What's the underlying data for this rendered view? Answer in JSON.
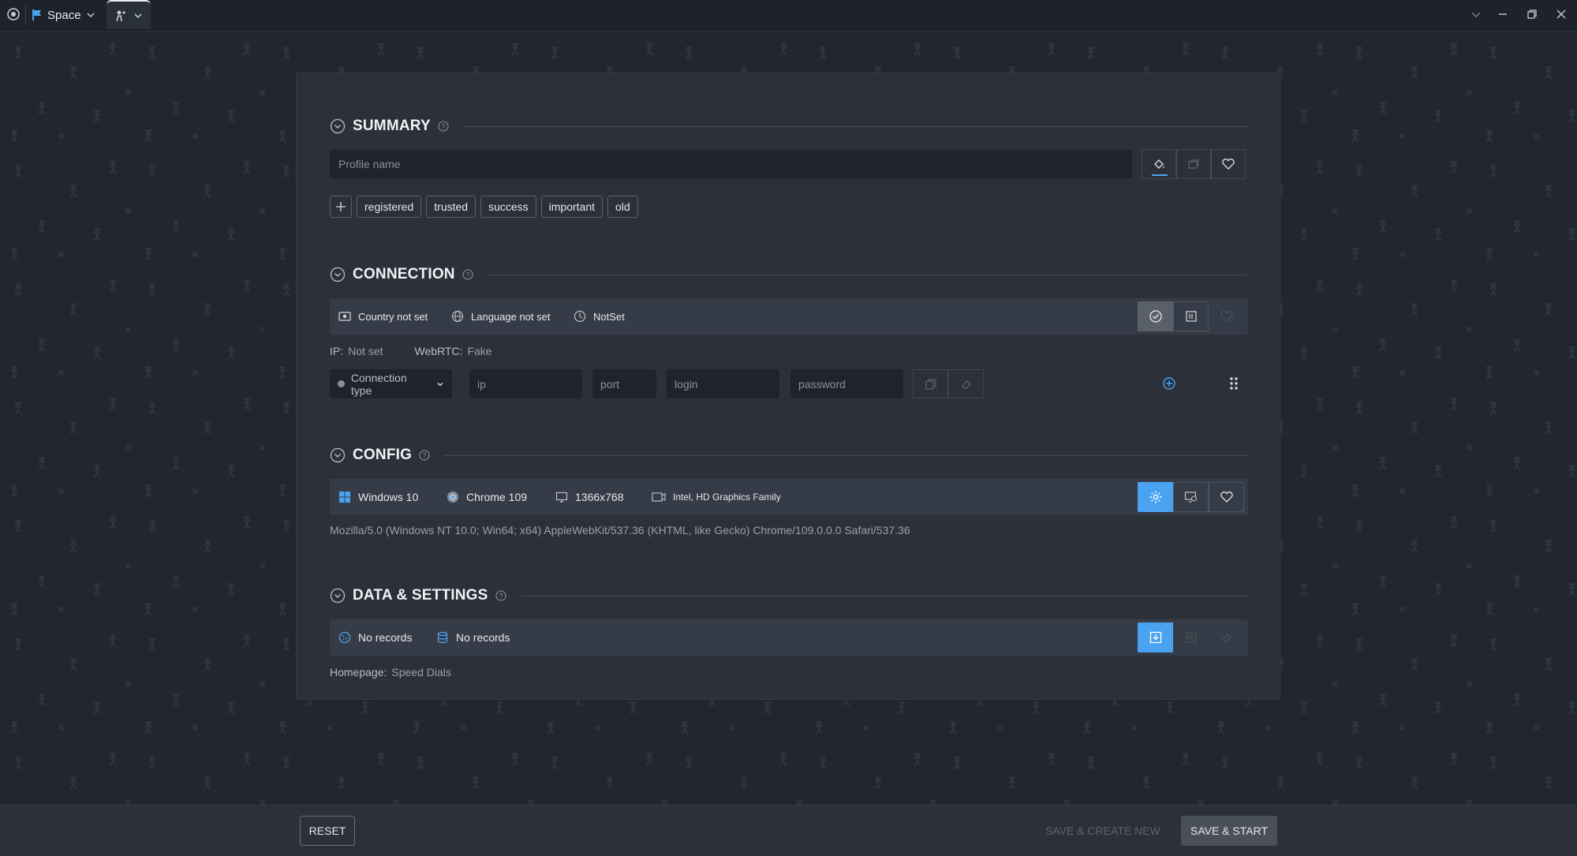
{
  "titlebar": {
    "space_label": "Space"
  },
  "summary": {
    "title": "SUMMARY",
    "profile_name_placeholder": "Profile name",
    "tags": [
      "registered",
      "trusted",
      "success",
      "important",
      "old"
    ]
  },
  "connection": {
    "title": "CONNECTION",
    "country": "Country not set",
    "language": "Language not set",
    "timezone": "NotSet",
    "ip_label": "IP:",
    "ip_value": "Not set",
    "webrtc_label": "WebRTC:",
    "webrtc_value": "Fake",
    "connection_type": "Connection type",
    "ip_placeholder": "ip",
    "port_placeholder": "port",
    "login_placeholder": "login",
    "password_placeholder": "password"
  },
  "config": {
    "title": "CONFIG",
    "os": "Windows 10",
    "browser": "Chrome 109",
    "resolution": "1366x768",
    "gpu": "Intel, HD Graphics Family",
    "user_agent": "Mozilla/5.0 (Windows NT 10.0; Win64; x64) AppleWebKit/537.36 (KHTML, like Gecko) Chrome/109.0.0.0 Safari/537.36"
  },
  "data_settings": {
    "title": "DATA & SETTINGS",
    "cookies": "No records",
    "storage": "No records",
    "homepage_label": "Homepage:",
    "homepage_value": "Speed Dials"
  },
  "footer": {
    "reset": "RESET",
    "save_create_new": "SAVE & CREATE NEW",
    "save_start": "SAVE & START"
  },
  "colors": {
    "accent": "#4aa3f0",
    "background": "#22272f",
    "panel": "#2b3039",
    "bar": "#363c47"
  }
}
